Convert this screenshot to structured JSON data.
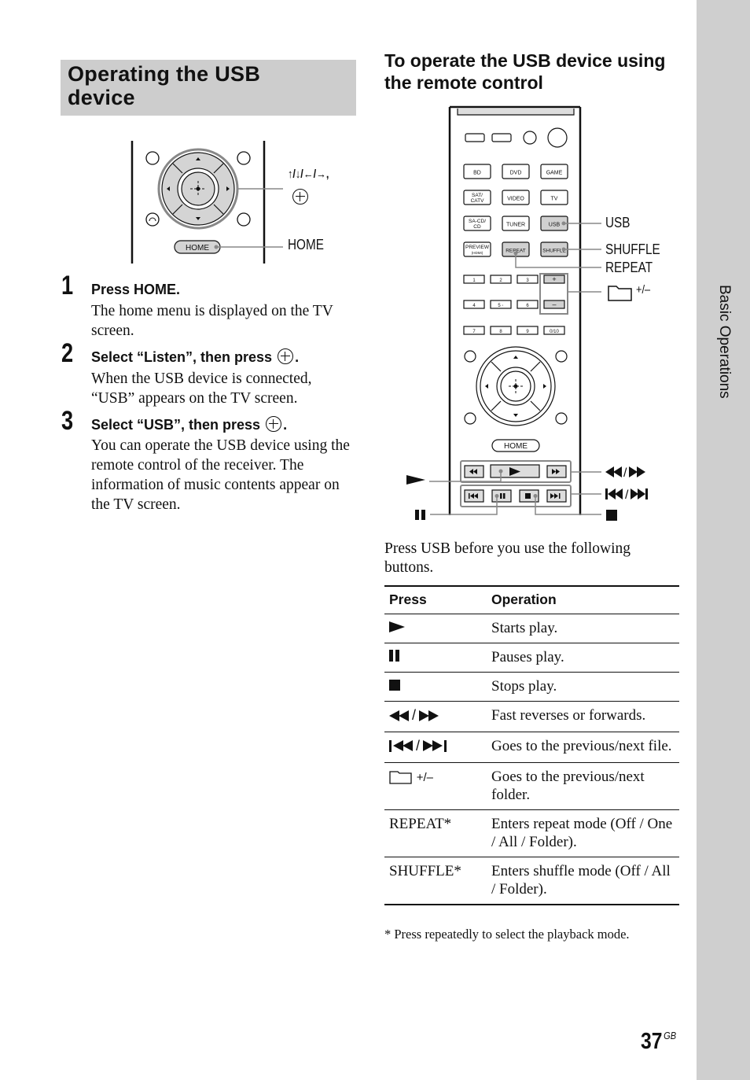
{
  "side_tab": {
    "label": "Basic Operations"
  },
  "section_title": "Operating the USB device",
  "subsection_title": "To operate the USB device using the remote control",
  "left_figure": {
    "callouts": {
      "arrows_label": "↑/↓/←/→,",
      "home_label": "HOME"
    },
    "home_button_label": "HOME"
  },
  "steps": [
    {
      "number": "1",
      "heading": "Press HOME.",
      "body": "The home menu is displayed on the TV screen."
    },
    {
      "number": "2",
      "heading_pre": "Select “Listen”, then press",
      "heading_post": ".",
      "body": "When the USB device is connected, “USB” appears on the TV screen."
    },
    {
      "number": "3",
      "heading_pre": "Select “USB”, then press",
      "heading_post": ".",
      "body": "You can operate the USB device using the remote control of the receiver. The information of music contents appear on the TV screen."
    }
  ],
  "remote": {
    "input_buttons": [
      [
        "BD",
        "DVD",
        "GAME"
      ],
      [
        "SAT/ CATV",
        "VIDEO",
        "TV"
      ],
      [
        "SA-CD/ CD",
        "TUNER",
        "USB"
      ],
      [
        "PREVIEW (HDMI)",
        "REPEAT",
        "SHUFFLE"
      ]
    ],
    "number_buttons": [
      [
        "1",
        "2",
        "3",
        "+"
      ],
      [
        "4",
        "5 ◦",
        "6",
        "–"
      ],
      [
        "7",
        "8",
        "9",
        "0/10"
      ]
    ],
    "home_button": "HOME",
    "callouts": {
      "usb": "USB",
      "shuffle": "SHUFFLE",
      "repeat": "REPEAT",
      "folder": "+/–"
    }
  },
  "intro_text": "Press USB before you use the following buttons.",
  "table": {
    "headers": [
      "Press",
      "Operation"
    ],
    "rows": [
      {
        "press_icon": "play-icon",
        "operation": "Starts play."
      },
      {
        "press_icon": "pause-icon",
        "operation": "Pauses play."
      },
      {
        "press_icon": "stop-icon",
        "operation": "Stops play."
      },
      {
        "press_icon": "rewind-forward-icon",
        "operation": "Fast reverses or forwards."
      },
      {
        "press_icon": "prev-next-icon",
        "operation": "Goes to the previous/next file."
      },
      {
        "press_icon": "folder-icon",
        "press_text": "+/–",
        "operation": "Goes to the previous/next folder."
      },
      {
        "press_text": "REPEAT*",
        "operation": "Enters repeat mode (Off / One / All / Folder)."
      },
      {
        "press_text": "SHUFFLE*",
        "operation": "Enters shuffle mode (Off / All / Folder)."
      }
    ]
  },
  "footnote": "* Press repeatedly to select the playback mode.",
  "page": {
    "number": "37",
    "suffix": "GB"
  }
}
